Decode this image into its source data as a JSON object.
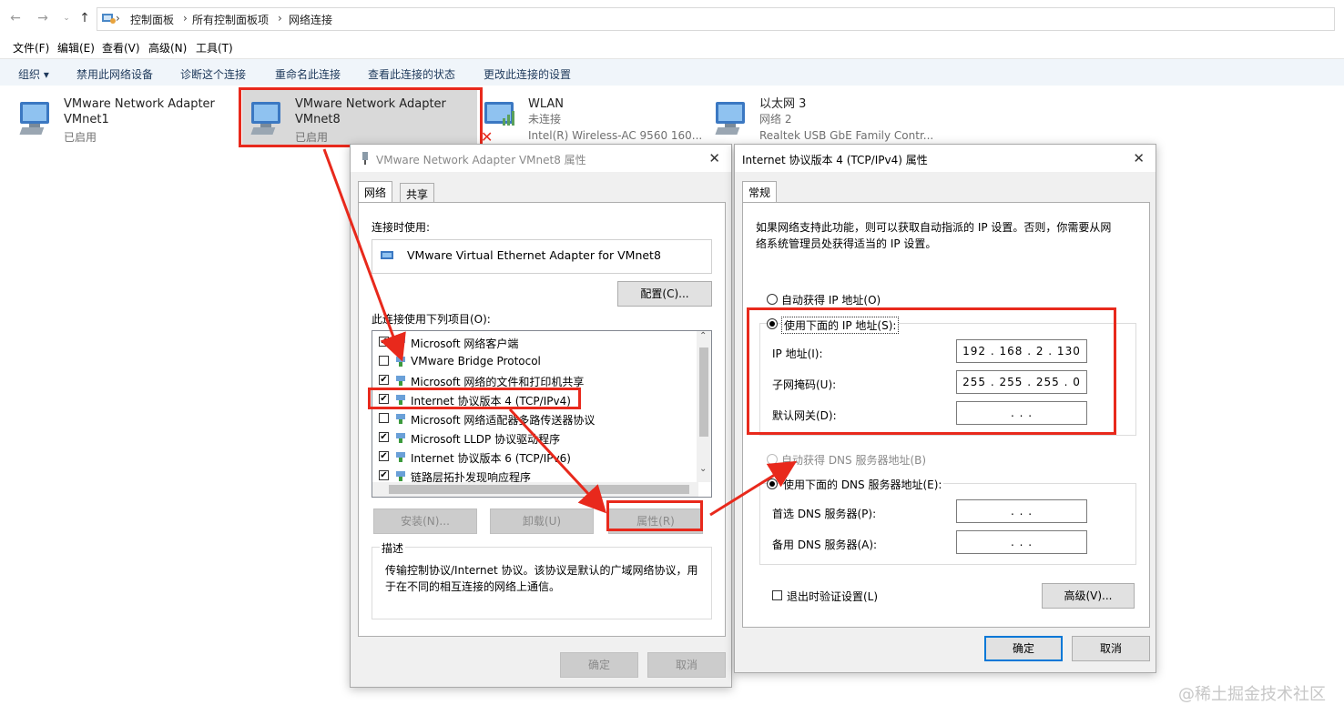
{
  "breadcrumb": [
    "控制面板",
    "所有控制面板项",
    "网络连接"
  ],
  "menubar": [
    "文件(F)",
    "编辑(E)",
    "查看(V)",
    "高级(N)",
    "工具(T)"
  ],
  "commands": [
    "组织 ▾",
    "禁用此网络设备",
    "诊断这个连接",
    "重命名此连接",
    "查看此连接的状态",
    "更改此连接的设置"
  ],
  "adapters": [
    {
      "name1": "VMware Network Adapter",
      "name2": "VMnet1",
      "status": "已启用"
    },
    {
      "name1": "VMware Network Adapter",
      "name2": "VMnet8",
      "status": "已启用"
    },
    {
      "name1": "WLAN",
      "name2": "未连接",
      "status": "Intel(R) Wireless-AC 9560 160..."
    },
    {
      "name1": "以太网 3",
      "name2": "网络 2",
      "status": "Realtek USB GbE Family Contr..."
    }
  ],
  "props": {
    "title": "VMware Network Adapter VMnet8 属性",
    "tabs": [
      "网络",
      "共享"
    ],
    "connect_using_label": "连接时使用:",
    "adapter_name": "VMware Virtual Ethernet Adapter for VMnet8",
    "configure": "配置(C)...",
    "items_label": "此连接使用下列项目(O):",
    "items": [
      {
        "label": "Microsoft 网络客户端",
        "checked": true
      },
      {
        "label": "VMware Bridge Protocol",
        "checked": false
      },
      {
        "label": "Microsoft 网络的文件和打印机共享",
        "checked": true
      },
      {
        "label": "Internet 协议版本 4 (TCP/IPv4)",
        "checked": true
      },
      {
        "label": "Microsoft 网络适配器多路传送器协议",
        "checked": false
      },
      {
        "label": "Microsoft LLDP 协议驱动程序",
        "checked": true
      },
      {
        "label": "Internet 协议版本 6 (TCP/IPv6)",
        "checked": true
      },
      {
        "label": "链路层拓扑发现响应程序",
        "checked": true
      }
    ],
    "install": "安装(N)...",
    "uninstall": "卸载(U)",
    "properties": "属性(R)",
    "desc_title": "描述",
    "desc_text1": "传输控制协议/Internet 协议。该协议是默认的广域网络协议，用",
    "desc_text2": "于在不同的相互连接的网络上通信。",
    "ok": "确定",
    "cancel": "取消"
  },
  "ipv4": {
    "title": "Internet 协议版本 4 (TCP/IPv4) 属性",
    "tab": "常规",
    "intro1": "如果网络支持此功能，则可以获取自动指派的 IP 设置。否则，你需要从网",
    "intro2": "络系统管理员处获得适当的 IP 设置。",
    "auto_ip": "自动获得 IP 地址(O)",
    "manual_ip": "使用下面的 IP 地址(S):",
    "ip_label": "IP 地址(I):",
    "ip_value": "192 . 168 .  2  . 130",
    "mask_label": "子网掩码(U):",
    "mask_value": "255 . 255 . 255 .  0",
    "gw_label": "默认网关(D):",
    "gw_value": ".     .     .",
    "auto_dns": "自动获得 DNS 服务器地址(B)",
    "manual_dns": "使用下面的 DNS 服务器地址(E):",
    "dns1_label": "首选 DNS 服务器(P):",
    "dns1_value": ".     .     .",
    "dns2_label": "备用 DNS 服务器(A):",
    "dns2_value": ".     .     .",
    "validate": "退出时验证设置(L)",
    "advanced": "高级(V)...",
    "ok": "确定",
    "cancel": "取消"
  },
  "watermark": "@稀土掘金技术社区",
  "colors": {
    "highlight": "#e8291c",
    "accent": "#0078d7"
  }
}
